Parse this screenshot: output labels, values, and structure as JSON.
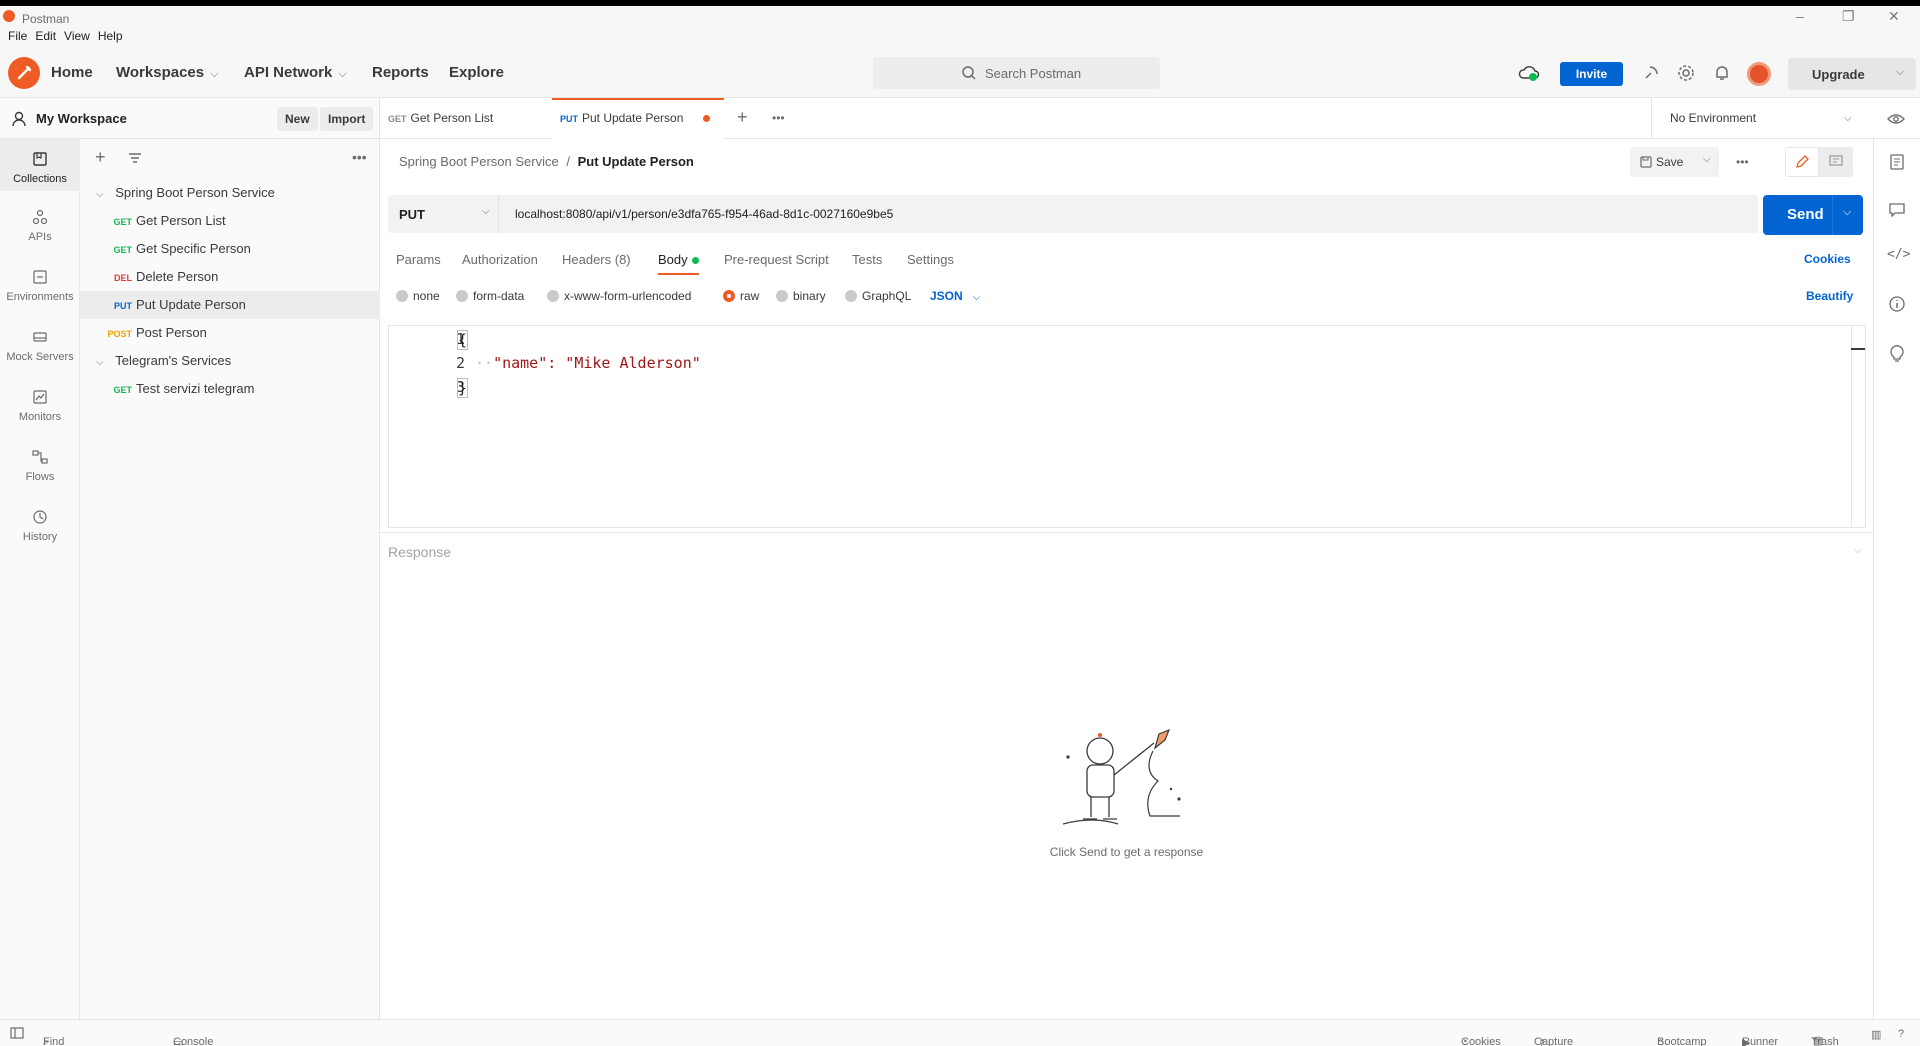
{
  "window": {
    "title": "Postman",
    "minimize": "–",
    "restore": "❐",
    "close": "✕"
  },
  "menu": [
    "File",
    "Edit",
    "View",
    "Help"
  ],
  "header": {
    "nav": [
      {
        "label": "Home",
        "chevron": false
      },
      {
        "label": "Workspaces",
        "chevron": true
      },
      {
        "label": "API Network",
        "chevron": true
      },
      {
        "label": "Reports",
        "chevron": false
      },
      {
        "label": "Explore",
        "chevron": false
      }
    ],
    "search_placeholder": "Search Postman",
    "invite_label": "Invite",
    "upgrade_label": "Upgrade"
  },
  "workspace": {
    "name": "My Workspace",
    "new_label": "New",
    "import_label": "Import"
  },
  "rail": [
    {
      "label": "Collections",
      "icon": "collections-icon"
    },
    {
      "label": "APIs",
      "icon": "apis-icon"
    },
    {
      "label": "Environments",
      "icon": "environments-icon"
    },
    {
      "label": "Mock Servers",
      "icon": "mock-servers-icon"
    },
    {
      "label": "Monitors",
      "icon": "monitors-icon"
    },
    {
      "label": "Flows",
      "icon": "flows-icon"
    },
    {
      "label": "History",
      "icon": "history-icon"
    }
  ],
  "tree": [
    {
      "type": "folder",
      "label": "Spring Boot Person Service"
    },
    {
      "type": "request",
      "method": "GET",
      "label": "Get Person List"
    },
    {
      "type": "request",
      "method": "GET",
      "label": "Get Specific Person"
    },
    {
      "type": "request",
      "method": "DEL",
      "label": "Delete Person"
    },
    {
      "type": "request",
      "method": "PUT",
      "label": "Put Update Person",
      "selected": true
    },
    {
      "type": "request",
      "method": "POST",
      "label": "Post Person"
    },
    {
      "type": "folder",
      "label": "Telegram's Services"
    },
    {
      "type": "request",
      "method": "GET",
      "label": "Test servizi telegram"
    }
  ],
  "tabs": [
    {
      "method": "GET",
      "label": "Get Person List"
    },
    {
      "method": "PUT",
      "label": "Put Update Person",
      "active": true,
      "unsaved": true
    }
  ],
  "environment": "No Environment",
  "breadcrumb": {
    "parent": "Spring Boot Person Service",
    "separator": "/",
    "current": "Put Update Person"
  },
  "save_label": "Save",
  "request": {
    "method": "PUT",
    "url": "localhost:8080/api/v1/person/e3dfa765-f954-46ad-8d1c-0027160e9be5",
    "send_label": "Send"
  },
  "request_tabs": [
    "Params",
    "Authorization",
    "Headers (8)",
    "Body",
    "Pre-request Script",
    "Tests",
    "Settings"
  ],
  "cookies_label": "Cookies",
  "body_types": [
    "none",
    "form-data",
    "x-www-form-urlencoded",
    "raw",
    "binary",
    "GraphQL"
  ],
  "body_format": "JSON",
  "beautify_label": "Beautify",
  "editor": {
    "line_numbers": [
      "1",
      "2",
      "3"
    ],
    "lines": [
      "{",
      "\"name\": \"Mike Alderson\"",
      "}"
    ]
  },
  "response": {
    "label": "Response",
    "hint": "Click Send to get a response"
  },
  "status_bar": {
    "find_replace": "Find and Replace",
    "console": "Console",
    "cookies": "Cookies",
    "capture": "Capture requests",
    "bootcamp": "Bootcamp",
    "runner": "Runner",
    "trash": "Trash"
  },
  "colors": {
    "accent": "#ef5b25",
    "primary_button": "#0265d2",
    "get": "#0cbb52",
    "put": "#0265d2",
    "post": "#f0a000",
    "del": "#e53935"
  }
}
